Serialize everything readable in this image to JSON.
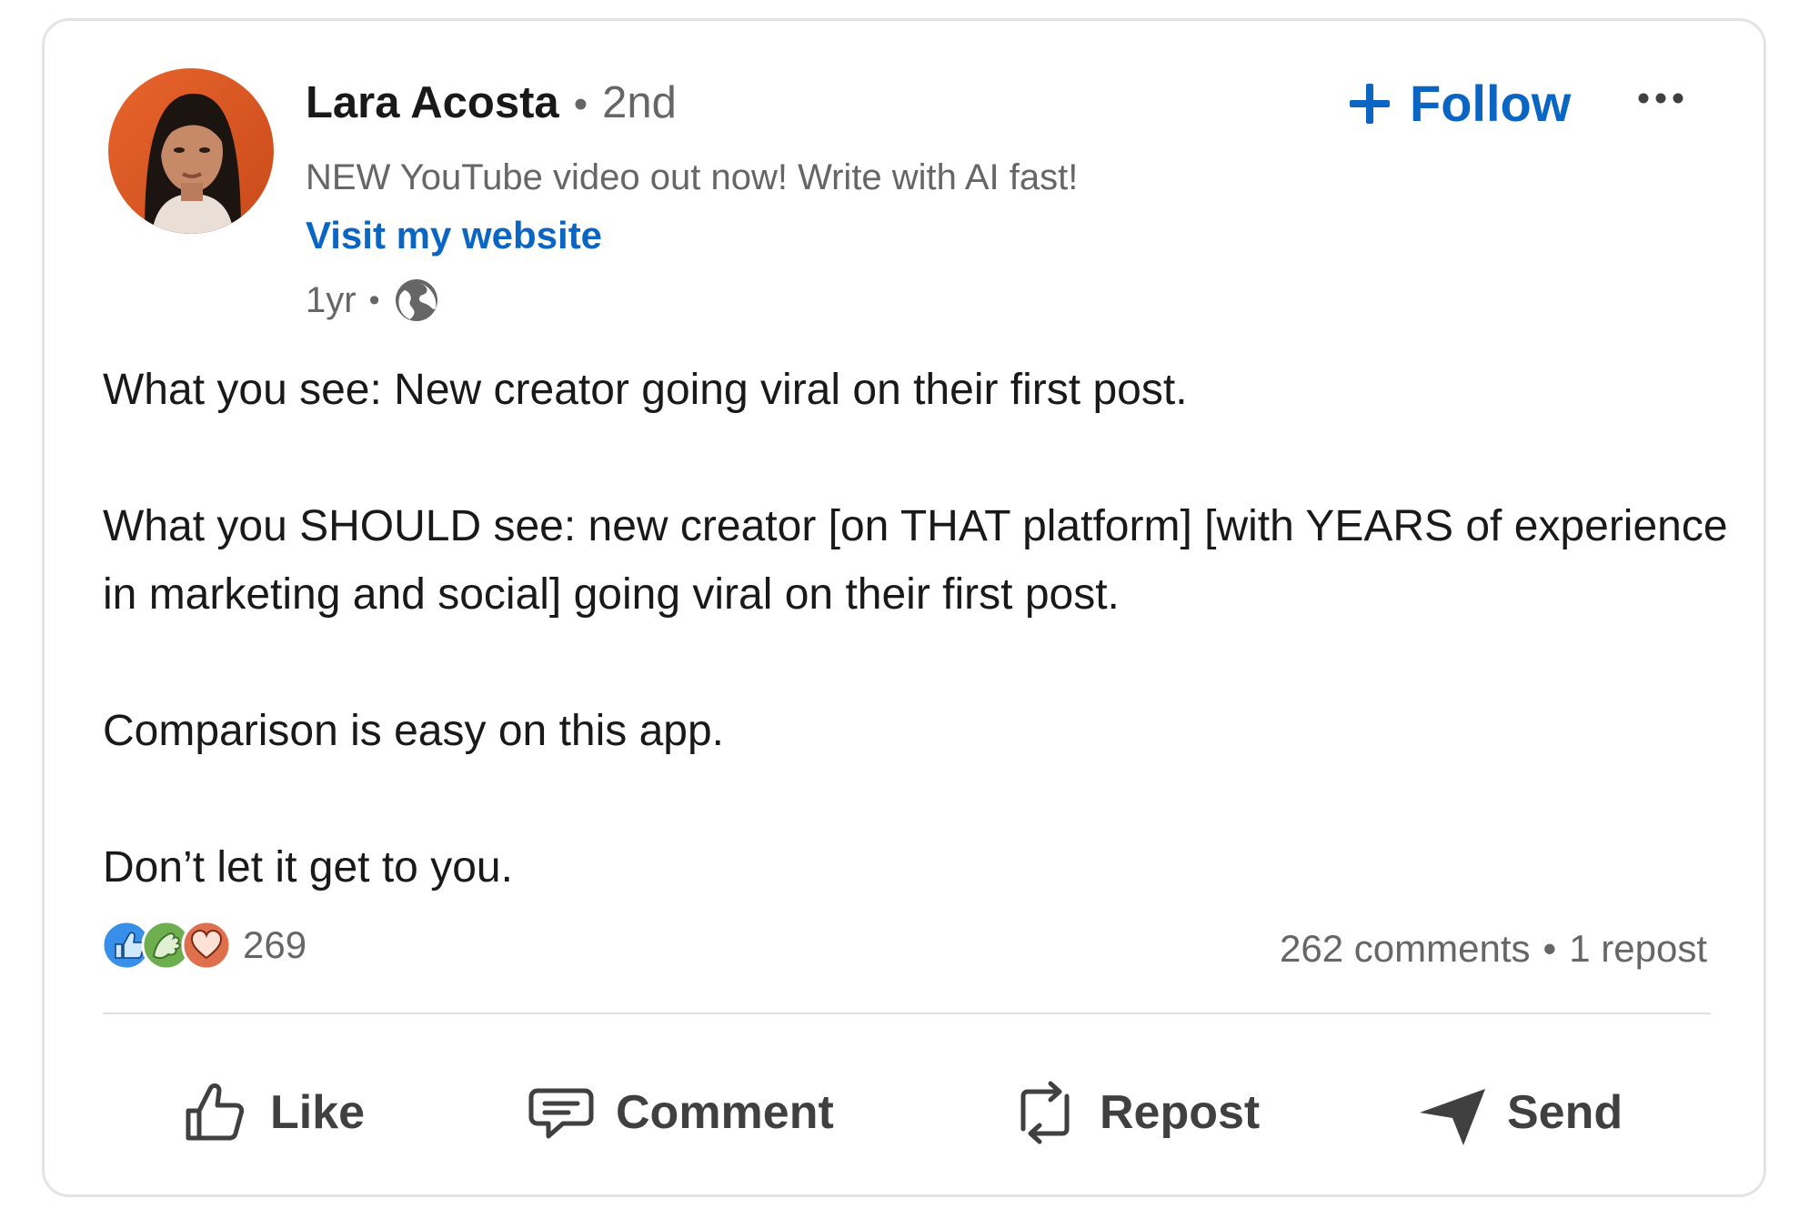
{
  "author": {
    "name": "Lara Acosta",
    "degree": "2nd",
    "separator": "•",
    "headline": "NEW YouTube video out now! Write with AI fast!",
    "website_link": "Visit my website",
    "time": "1yr",
    "visibility_icon": "globe-icon"
  },
  "header_actions": {
    "follow_label": "Follow",
    "follow_icon": "plus-icon",
    "more_icon": "ellipsis-icon"
  },
  "post": {
    "paragraphs": [
      "What you see: New creator going viral on their first post.",
      "What you SHOULD see: new creator [on THAT platform] [with YEARS of experience in marketing and social] going viral on their first post.",
      "Comparison is easy on this app.",
      "Don’t let it get to you."
    ]
  },
  "social": {
    "reaction_icons": [
      "like-reaction-icon",
      "celebrate-reaction-icon",
      "love-reaction-icon"
    ],
    "reaction_count": "269",
    "comments": "262 comments",
    "reposts": "1 repost"
  },
  "actions": {
    "like": "Like",
    "comment": "Comment",
    "repost": "Repost",
    "send": "Send"
  },
  "colors": {
    "link_blue": "#0a66c2",
    "muted_text": "#666666",
    "like_blue": "#378fe9",
    "celebrate_green": "#44712e",
    "love_red": "#df704d"
  }
}
